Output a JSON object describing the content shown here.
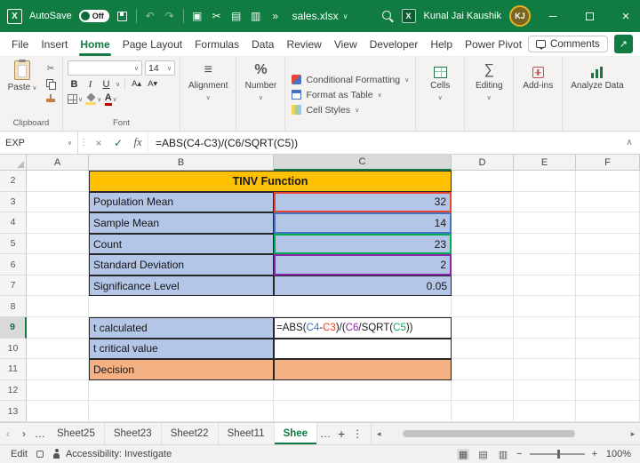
{
  "titlebar": {
    "autosave_label": "AutoSave",
    "autosave_state": "Off",
    "filename": "sales.xlsx",
    "user_name": "Kunal Jai Kaushik",
    "user_initials": "KJ"
  },
  "menu": {
    "items": [
      "File",
      "Insert",
      "Home",
      "Page Layout",
      "Formulas",
      "Data",
      "Review",
      "View",
      "Developer",
      "Help",
      "Power Pivot"
    ],
    "active": "Home",
    "comments_label": "Comments"
  },
  "ribbon": {
    "paste_label": "Paste",
    "clipboard_label": "Clipboard",
    "font_label": "Font",
    "font_size": "14",
    "bold_icon": "B",
    "italic_icon": "I",
    "underline_icon": "U",
    "alignment_label": "Alignment",
    "number_label": "Number",
    "styles_items": [
      "Conditional Formatting",
      "Format as Table",
      "Cell Styles"
    ],
    "cells_label": "Cells",
    "editing_label": "Editing",
    "addins_label": "Add-ins",
    "analyze_label": "Analyze Data"
  },
  "formula_bar": {
    "name_box": "EXP",
    "fx_label": "fx",
    "formula": "=ABS(C4-C3)/(C6/SQRT(C5))"
  },
  "sheet": {
    "col_headers": [
      "A",
      "B",
      "C",
      "D",
      "E",
      "F"
    ],
    "active_col": "C",
    "active_row": "9",
    "row_numbers": [
      "2",
      "3",
      "4",
      "5",
      "6",
      "7",
      "8",
      "9",
      "10",
      "11",
      "12",
      "13"
    ],
    "title_row": "2",
    "title_text": "TINV Function",
    "data_rows": [
      {
        "row": "3",
        "label": "Population Mean",
        "value": "32",
        "ref_color": "#e8442e"
      },
      {
        "row": "4",
        "label": "Sample Mean",
        "value": "14",
        "ref_color": "#4472c4"
      },
      {
        "row": "5",
        "label": "Count",
        "value": "23",
        "ref_color": "#00b050"
      },
      {
        "row": "6",
        "label": "Standard Deviation",
        "value": "2",
        "ref_color": "#8e24aa"
      },
      {
        "row": "7",
        "label": "Significance Level",
        "value": "0.05",
        "ref_color": ""
      }
    ],
    "result_rows": [
      {
        "row": "9",
        "label": "t calculated",
        "label_fill": "blue",
        "value_fill": "white",
        "has_formula": true
      },
      {
        "row": "10",
        "label": "t critical value",
        "label_fill": "blue",
        "value_fill": "white",
        "has_formula": false
      },
      {
        "row": "11",
        "label": "Decision",
        "label_fill": "orange",
        "value_fill": "orange",
        "has_formula": false
      }
    ],
    "formula_parts": [
      {
        "text": "=ABS(",
        "color": "#1a1a1a"
      },
      {
        "text": "C4",
        "color": "#4472c4"
      },
      {
        "text": "-",
        "color": "#1a1a1a"
      },
      {
        "text": "C3",
        "color": "#e8442e"
      },
      {
        "text": ")/(",
        "color": "#1a1a1a"
      },
      {
        "text": "C6",
        "color": "#8e24aa"
      },
      {
        "text": "/SQRT(",
        "color": "#1a1a1a"
      },
      {
        "text": "C5",
        "color": "#00b050"
      },
      {
        "text": "))",
        "color": "#1a1a1a"
      }
    ]
  },
  "tabs": {
    "items": [
      "Sheet25",
      "Sheet23",
      "Sheet22",
      "Sheet11"
    ],
    "active": "Shee"
  },
  "status": {
    "mode": "Edit",
    "accessibility_label": "Accessibility: Investigate",
    "zoom": "100%"
  },
  "colors": {
    "excel_green": "#107C41",
    "title_fill": "#FFC000",
    "label_fill": "#B4C6E7",
    "decision_fill": "#F4B183",
    "annotation_red": "#E2261A"
  }
}
